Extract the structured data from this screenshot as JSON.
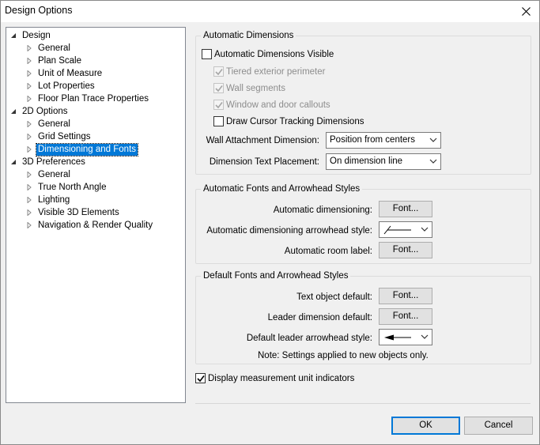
{
  "window": {
    "title": "Design Options"
  },
  "tree": {
    "items": [
      {
        "label": "Design",
        "level": 0,
        "expanded": true,
        "selected": false
      },
      {
        "label": "General",
        "level": 1,
        "expanded": false,
        "selected": false
      },
      {
        "label": "Plan Scale",
        "level": 1,
        "expanded": false,
        "selected": false
      },
      {
        "label": "Unit of Measure",
        "level": 1,
        "expanded": false,
        "selected": false
      },
      {
        "label": "Lot Properties",
        "level": 1,
        "expanded": false,
        "selected": false
      },
      {
        "label": "Floor Plan Trace Properties",
        "level": 1,
        "expanded": false,
        "selected": false
      },
      {
        "label": "2D Options",
        "level": 0,
        "expanded": true,
        "selected": false
      },
      {
        "label": "General",
        "level": 1,
        "expanded": false,
        "selected": false
      },
      {
        "label": "Grid Settings",
        "level": 1,
        "expanded": false,
        "selected": false
      },
      {
        "label": "Dimensioning and Fonts",
        "level": 1,
        "expanded": false,
        "selected": true
      },
      {
        "label": "3D Preferences",
        "level": 0,
        "expanded": true,
        "selected": false
      },
      {
        "label": "General",
        "level": 1,
        "expanded": false,
        "selected": false
      },
      {
        "label": "True North Angle",
        "level": 1,
        "expanded": false,
        "selected": false
      },
      {
        "label": "Lighting",
        "level": 1,
        "expanded": false,
        "selected": false
      },
      {
        "label": "Visible 3D Elements",
        "level": 1,
        "expanded": false,
        "selected": false
      },
      {
        "label": "Navigation & Render Quality",
        "level": 1,
        "expanded": false,
        "selected": false
      }
    ]
  },
  "auto_dims": {
    "title": "Automatic Dimensions",
    "visible": {
      "label": "Automatic Dimensions Visible",
      "checked": false
    },
    "tiered": {
      "label": "Tiered exterior perimeter",
      "checked": true
    },
    "wall_segments": {
      "label": "Wall segments",
      "checked": true
    },
    "window_door": {
      "label": "Window and door callouts",
      "checked": true
    },
    "cursor_tracking": {
      "label": "Draw Cursor Tracking Dimensions",
      "checked": false
    },
    "wall_attach": {
      "label": "Wall Attachment Dimension:",
      "value": "Position from centers"
    },
    "text_placement": {
      "label": "Dimension Text Placement:",
      "value": "On dimension line"
    }
  },
  "auto_fonts": {
    "title": "Automatic Fonts and Arrowhead Styles",
    "dimensioning": {
      "label": "Automatic dimensioning:",
      "button": "Font..."
    },
    "arrowhead": {
      "label": "Automatic dimensioning arrowhead style:",
      "icon": "slash-tick-arrowhead"
    },
    "room_label": {
      "label": "Automatic room label:",
      "button": "Font..."
    }
  },
  "default_fonts": {
    "title": "Default Fonts and Arrowhead Styles",
    "text_object": {
      "label": "Text object default:",
      "button": "Font..."
    },
    "leader_dim": {
      "label": "Leader dimension default:",
      "button": "Font..."
    },
    "leader_arrow": {
      "label": "Default leader arrowhead style:",
      "icon": "solid-arrowhead"
    },
    "note": "Note: Settings applied to new objects only."
  },
  "display_units": {
    "label": "Display measurement unit indicators",
    "checked": true
  },
  "footer": {
    "ok": "OK",
    "cancel": "Cancel"
  },
  "colors": {
    "selection": "#0078d7",
    "default_button_border": "#0078d7"
  }
}
